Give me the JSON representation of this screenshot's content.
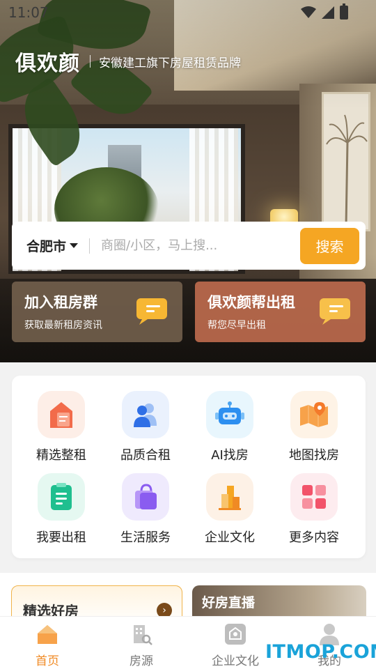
{
  "status_bar": {
    "time": "11:07"
  },
  "brand": {
    "name": "俱欢颜",
    "slogan": "安徽建工旗下房屋租赁品牌"
  },
  "search": {
    "city": "合肥市",
    "placeholder": "商圈/小区，马上搜...",
    "button_label": "搜索"
  },
  "promos": [
    {
      "title": "加入租房群",
      "subtitle": "获取最新租房资讯"
    },
    {
      "title": "俱欢颜帮出租",
      "subtitle": "帮您尽早出租"
    }
  ],
  "features": [
    {
      "label": "精选整租",
      "icon": "house-doc-icon"
    },
    {
      "label": "品质合租",
      "icon": "people-icon"
    },
    {
      "label": "AI找房",
      "icon": "robot-icon"
    },
    {
      "label": "地图找房",
      "icon": "map-pin-icon"
    },
    {
      "label": "我要出租",
      "icon": "clipboard-icon"
    },
    {
      "label": "生活服务",
      "icon": "shopping-bag-icon"
    },
    {
      "label": "企业文化",
      "icon": "building-icon"
    },
    {
      "label": "更多内容",
      "icon": "grid-icon"
    }
  ],
  "cards": {
    "pick_title": "精选好房",
    "live_title": "好房直播"
  },
  "tabs": [
    {
      "label": "首页",
      "icon": "home-icon",
      "active": true
    },
    {
      "label": "房源",
      "icon": "building-search-icon",
      "active": false
    },
    {
      "label": "企业文化",
      "icon": "culture-icon",
      "active": false
    },
    {
      "label": "我的",
      "icon": "profile-icon",
      "active": false
    }
  ],
  "watermark": "ITMOP.COM",
  "colors": {
    "accent": "#f5a623",
    "tab_active": "#f08a24",
    "watermark": "#1aa3d9"
  }
}
